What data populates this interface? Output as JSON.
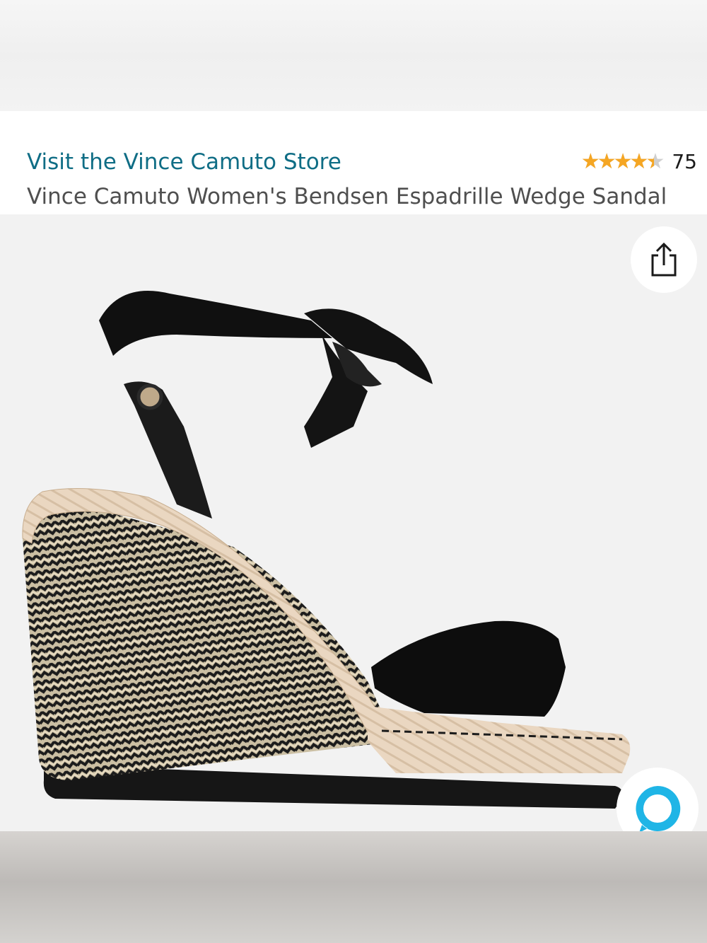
{
  "product": {
    "store_link": "Visit the Vince Camuto Store",
    "title": "Vince Camuto Women's Bendsen Espadrille Wedge Sandal",
    "rating": {
      "stars": 4.5,
      "stars_max": 5,
      "count": "75",
      "star_glyphs": "★★★★★"
    }
  },
  "icons": {
    "share": "share-icon",
    "alexa": "alexa-icon",
    "star": "star-icon"
  },
  "colors": {
    "link": "#0f6d85",
    "star": "#f5a623",
    "alexa": "#1fb5e6"
  }
}
